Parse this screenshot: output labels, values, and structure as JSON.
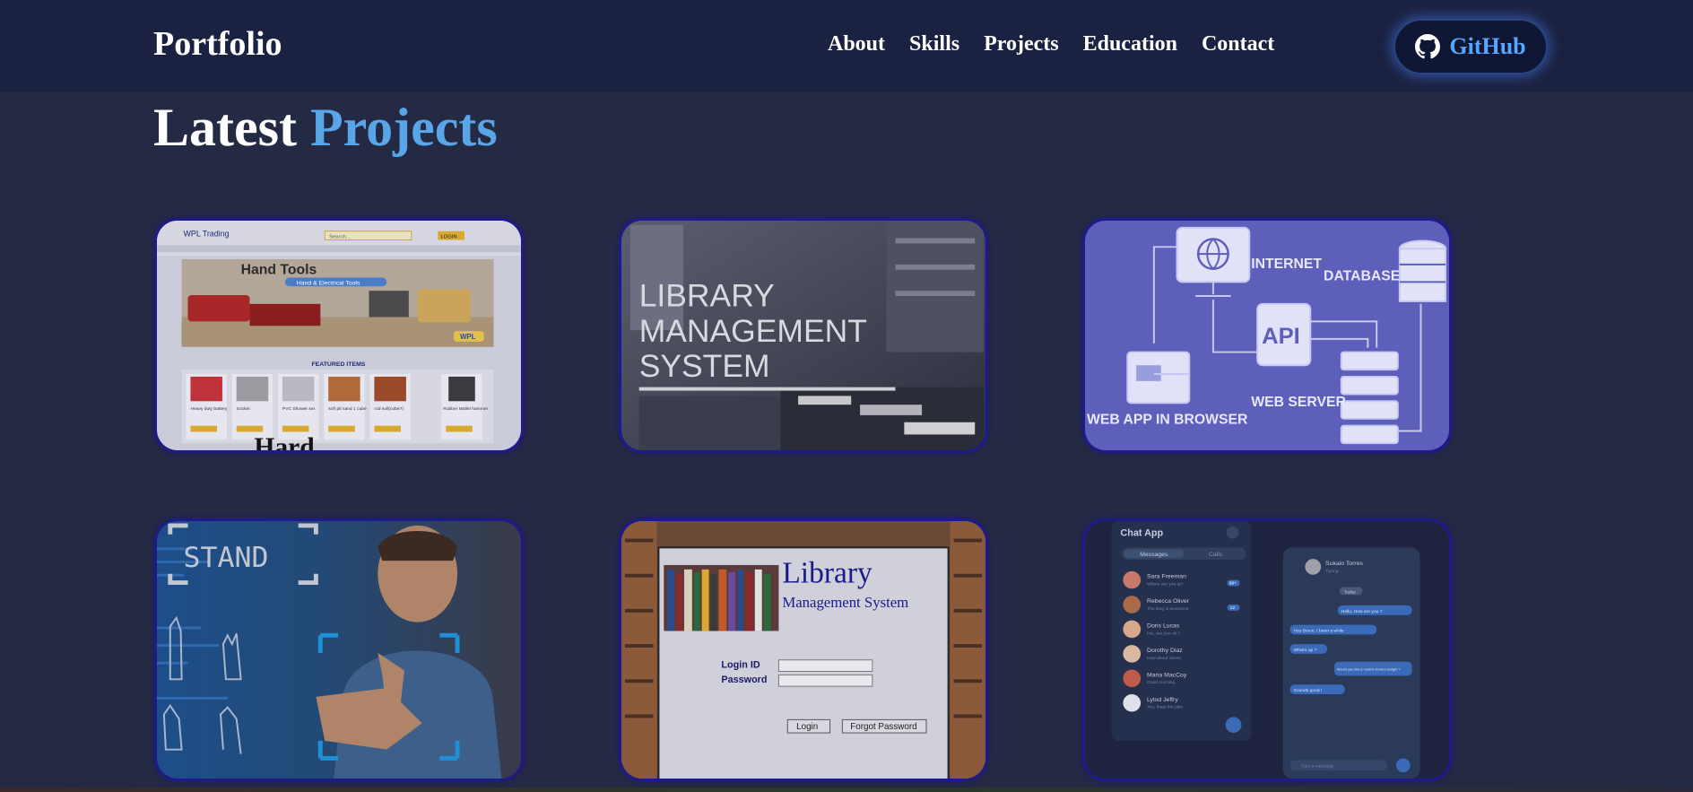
{
  "nav": {
    "brand": "Portfolio",
    "links": [
      "About",
      "Skills",
      "Projects",
      "Education",
      "Contact"
    ],
    "github_label": "GitHub",
    "github_icon": "github-icon"
  },
  "section": {
    "title_white": "Latest",
    "title_accent": "Projects"
  },
  "projects": [
    {
      "title": "Hand Tools",
      "subtitle": "Hand & Electrical Tools",
      "brand": "WPL Trading",
      "search_placeholder": "Search...",
      "login_label": "LOGIN",
      "featured_label": "FEATURED ITEMS",
      "items": [
        "Heavy duty battery",
        "Socket",
        "PVC Shower set",
        "soft pit sand 1 cube",
        "rod soil(cube?)",
        "Rubber Mallet hammer"
      ],
      "add_to_cart": "Add to cart",
      "badge": "WPL",
      "overflow_caption": "Hard"
    },
    {
      "title_lines": [
        "LIBRARY",
        "MANAGEMENT",
        "SYSTEM"
      ]
    },
    {
      "labels": [
        "INTERNET",
        "DATABASE",
        "API",
        "WEB APP IN BROWSER",
        "WEB SERVER"
      ]
    },
    {
      "label": "STAND"
    },
    {
      "title": "Library",
      "subtitle": "Management System",
      "login_id_label": "Login ID",
      "password_label": "Password",
      "login_button": "Login",
      "forgot_button": "Forgot Password"
    },
    {
      "title": "Chat App",
      "tabs": [
        "Messages",
        "Calls"
      ],
      "contacts": [
        {
          "name": "Sara Freeman",
          "preview": "Where are you at?",
          "badge": "99+"
        },
        {
          "name": "Rebecca Oliver",
          "preview": "The blog is awesome",
          "badge": "12"
        },
        {
          "name": "Doris Lucas",
          "preview": "Hei, are you ok ?",
          "badge": ""
        },
        {
          "name": "Dorothy Diaz",
          "preview": "How about dinner",
          "badge": ""
        },
        {
          "name": "Maria MacCoy",
          "preview": "Good morning",
          "badge": ""
        },
        {
          "name": "Lylod Jeffry",
          "preview": "Yes, thats the plan",
          "badge": ""
        }
      ],
      "conversation_name": "Sukaio Torres",
      "conversation_status": "Typing...",
      "date_chip": "Today",
      "messages": [
        "Hello, How are you ?",
        "Hey Bruce, I been a while",
        "What's up ?",
        "Would you like to watch movies tonight ?",
        "Sounds good !"
      ],
      "input_placeholder": "Type a message..."
    }
  ]
}
